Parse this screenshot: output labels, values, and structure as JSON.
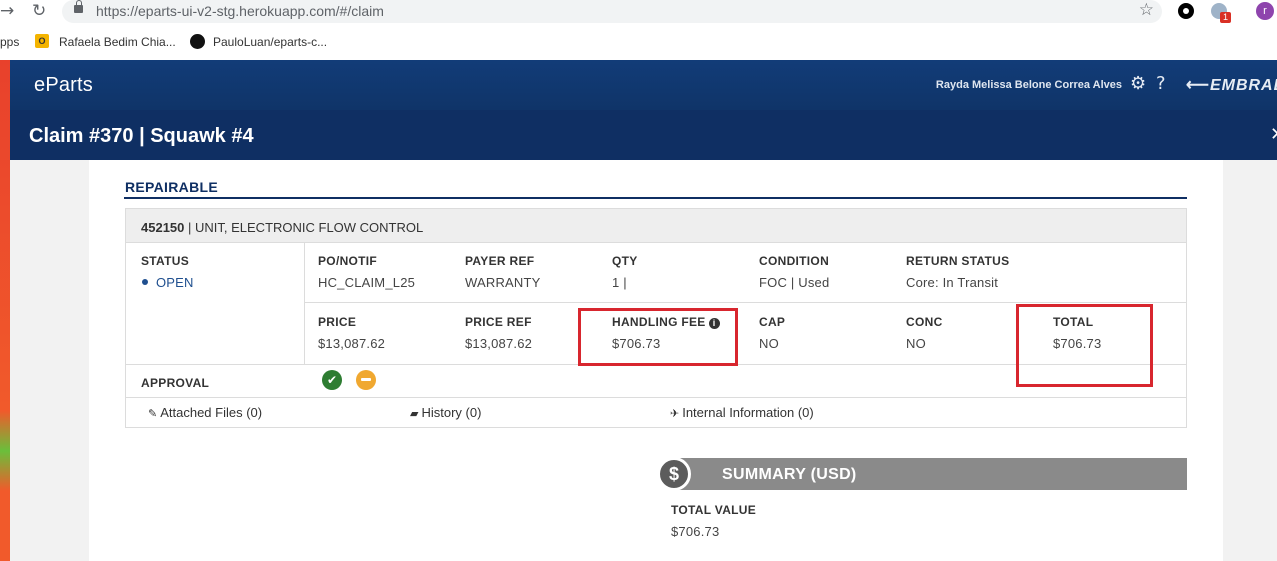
{
  "browser": {
    "url": "https://eparts-ui-v2-stg.herokuapp.com/#/claim",
    "extension_badge": "1",
    "profile_initial": "r",
    "bookmarks": [
      {
        "label": "pps"
      },
      {
        "label": "Rafaela Bedim Chia..."
      },
      {
        "label": "PauloLuan/eparts-c..."
      }
    ]
  },
  "header": {
    "brand": "eParts",
    "user": "Rayda Melissa Belone Correa Alves",
    "logo": "EMBRAER"
  },
  "page": {
    "title": "Claim #370 | Squawk #4"
  },
  "section": {
    "title": "REPAIRABLE"
  },
  "part": {
    "number": "452150",
    "description": " | UNIT, ELECTRONIC FLOW CONTROL",
    "status_label": "STATUS",
    "status_value": "OPEN",
    "row1": [
      {
        "label": "PO/NOTIF",
        "value": "HC_CLAIM_L25"
      },
      {
        "label": "PAYER REF",
        "value": "WARRANTY"
      },
      {
        "label": "QTY",
        "value": "1 |"
      },
      {
        "label": "CONDITION",
        "value": "FOC | Used"
      },
      {
        "label": "RETURN STATUS",
        "value": "Core: In Transit"
      }
    ],
    "row2": [
      {
        "label": "PRICE",
        "value": "$13,087.62"
      },
      {
        "label": "PRICE REF",
        "value": "$13,087.62"
      },
      {
        "label": "HANDLING FEE",
        "value": "$706.73"
      },
      {
        "label": "CAP",
        "value": "NO"
      },
      {
        "label": "CONC",
        "value": "NO"
      },
      {
        "label": "TOTAL",
        "value": "$706.73"
      }
    ],
    "approval_label": "APPROVAL",
    "tabs": [
      {
        "label": "Attached Files (0)"
      },
      {
        "label": "History (0)"
      },
      {
        "label": "Internal Information (0)"
      }
    ]
  },
  "summary": {
    "title": "SUMMARY (USD)",
    "total_label": "TOTAL VALUE",
    "total_value": "$706.73"
  },
  "colors": {
    "nav": "#123c78",
    "title_bar": "#0f2f63",
    "highlight": "#d8262e"
  },
  "icons": [
    "back-arrow-icon",
    "reload-icon",
    "lock-icon",
    "star-icon",
    "settings-icon",
    "help-icon",
    "info-icon",
    "check-icon",
    "pending-icon",
    "paperclip-icon",
    "book-icon",
    "plane-icon",
    "dollar-icon"
  ]
}
